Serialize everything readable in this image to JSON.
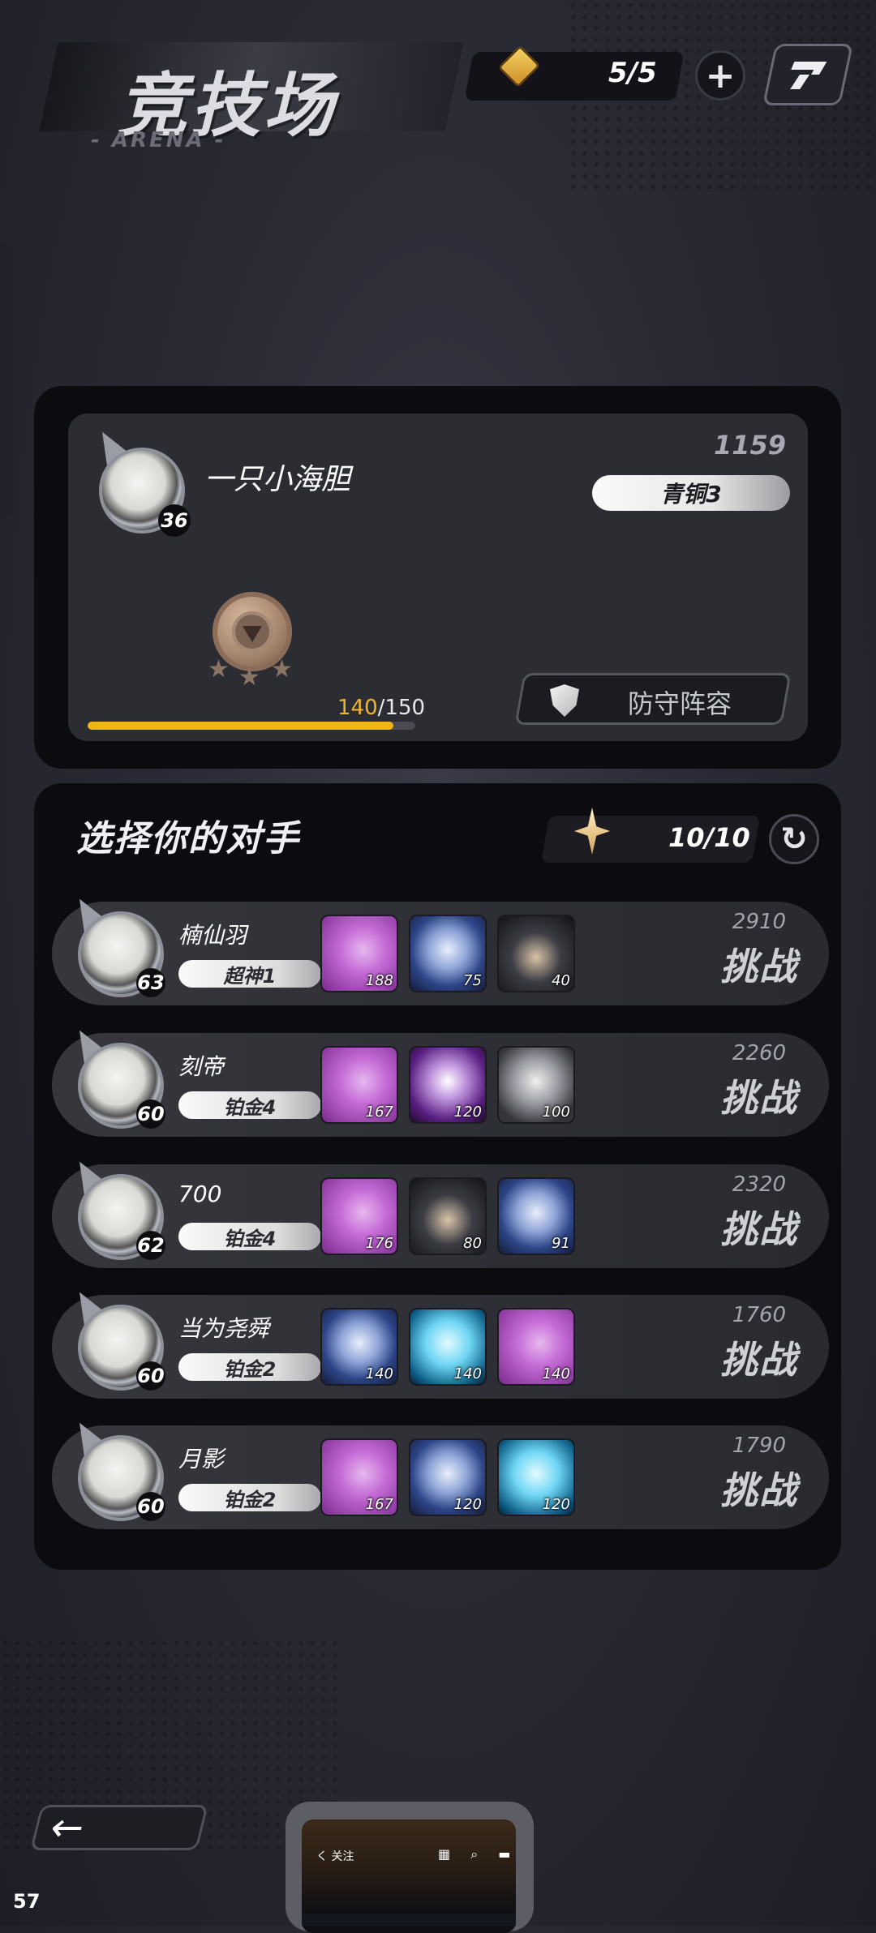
{
  "header": {
    "title": "竞技场",
    "subtitle": "- ARENA -",
    "tickets": "5/5",
    "plus_label": "+"
  },
  "profile": {
    "name": "一只小海胆",
    "level": "36",
    "score": "1159",
    "rank": "青铜3",
    "progress_current": "140",
    "progress_sep": "/",
    "progress_max": "150",
    "progress_fraction": 0.933,
    "stars": "★★★",
    "defense_label": "防守阵容"
  },
  "opponents": {
    "title": "选择你的对手",
    "refresh_count": "10/10",
    "refresh_icon": "refresh-icon",
    "list": [
      {
        "name": "楠仙羽",
        "level": "63",
        "rank": "超神1",
        "power": "2910",
        "action": "挑战",
        "heroes": [
          {
            "type": "pink",
            "lvl": "188"
          },
          {
            "type": "blue",
            "lvl": "75"
          },
          {
            "type": "dark",
            "lvl": "40"
          }
        ]
      },
      {
        "name": "刻帝",
        "level": "60",
        "rank": "铂金4",
        "power": "2260",
        "action": "挑战",
        "heroes": [
          {
            "type": "pink",
            "lvl": "167"
          },
          {
            "type": "violet",
            "lvl": "120"
          },
          {
            "type": "grey",
            "lvl": "100"
          }
        ]
      },
      {
        "name": "700",
        "level": "62",
        "rank": "铂金4",
        "power": "2320",
        "action": "挑战",
        "heroes": [
          {
            "type": "pink",
            "lvl": "176"
          },
          {
            "type": "dark",
            "lvl": "80"
          },
          {
            "type": "blue",
            "lvl": "91"
          }
        ]
      },
      {
        "name": "当为尧舜",
        "level": "60",
        "rank": "铂金2",
        "power": "1760",
        "action": "挑战",
        "heroes": [
          {
            "type": "blue",
            "lvl": "140"
          },
          {
            "type": "cyan",
            "lvl": "140"
          },
          {
            "type": "pink",
            "lvl": "140"
          }
        ]
      },
      {
        "name": "月影",
        "level": "60",
        "rank": "铂金2",
        "power": "1790",
        "action": "挑战",
        "heroes": [
          {
            "type": "pink",
            "lvl": "167"
          },
          {
            "type": "blue",
            "lvl": "120"
          },
          {
            "type": "cyan",
            "lvl": "120"
          }
        ]
      }
    ]
  },
  "footer": {
    "back_icon": "←",
    "fps": "57",
    "mini_back": "く 关注",
    "mini_icons": "▦ ⌕ ▬"
  },
  "colors": {
    "accent": "#f2b418",
    "panel": "#0c0c10",
    "card": "#2c2c33"
  }
}
